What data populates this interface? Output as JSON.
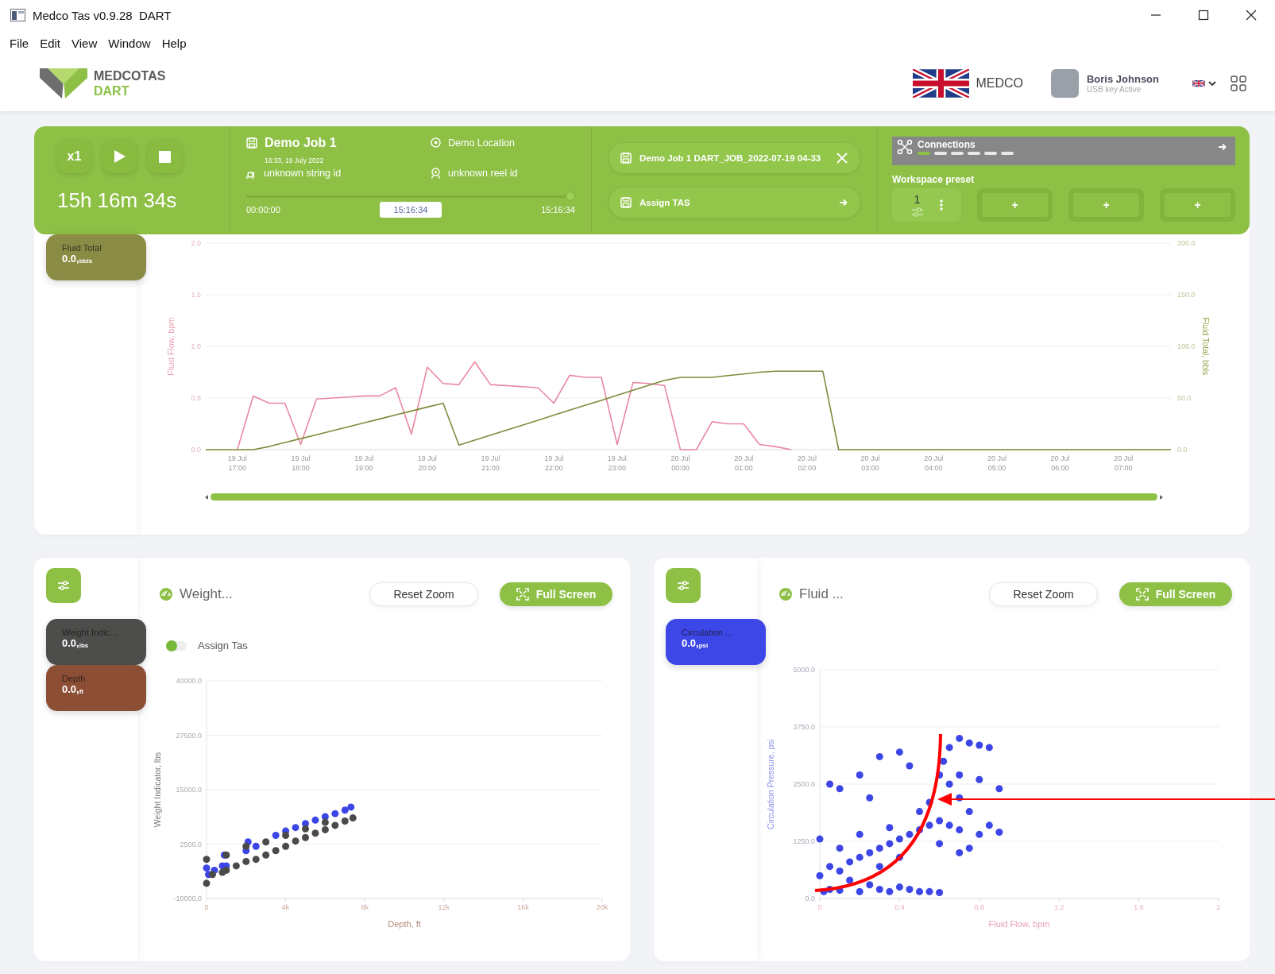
{
  "window": {
    "title": "Medco Tas v0.9.28  DART"
  },
  "menu": [
    "File",
    "Edit",
    "View",
    "Window",
    "Help"
  ],
  "header": {
    "logo": {
      "name": "MEDCOTAS",
      "sub": "DART"
    },
    "company": "MEDCO",
    "user": {
      "name": "Boris Johnson",
      "status": "USB key Active"
    }
  },
  "control_bar": {
    "speed": "x1",
    "elapsed": "15h 16m 34s",
    "job": {
      "title": "Demo Job 1",
      "date": "16:33, 19 July 2022",
      "string_id": "unknown string id",
      "location": "Demo Location",
      "reel_id": "unknown reel id"
    },
    "timeline": {
      "start": "00:00:00",
      "current": "15:16:34",
      "end": "15:16:34",
      "level": 1
    },
    "files": [
      {
        "label": "Demo Job 1 DART_JOB_2022-07-19 04-33",
        "kind": "close"
      },
      {
        "label": "Assign TAS",
        "kind": "arrow"
      }
    ],
    "connections": {
      "label": "Connections",
      "segments": [
        {
          "active": true
        },
        {
          "active": false
        },
        {
          "active": false
        },
        {
          "active": false
        },
        {
          "active": false
        },
        {
          "active": false
        }
      ]
    },
    "workspace": {
      "label": "Workspace preset",
      "slots": [
        {
          "kind": "preset",
          "label": "1"
        },
        {
          "kind": "add",
          "label": "+"
        },
        {
          "kind": "add",
          "label": "+"
        },
        {
          "kind": "add",
          "label": "+"
        }
      ]
    }
  },
  "trend_panel": {
    "badges": [
      {
        "label": "Fluid Total",
        "value": "0.0,$_{bbls}$",
        "color": "#8a8c45"
      }
    ],
    "chart_data": {
      "type": "line",
      "ylabel": "Fluid Flow, bpm",
      "y2label": "Fluid Total, bbls",
      "ylim": [
        0,
        2
      ],
      "y2lim": [
        0,
        200
      ],
      "categories": [
        null,
        null,
        "19 Jul 17:00",
        null,
        null,
        null,
        "19 Jul 18:00",
        null,
        null,
        null,
        "19 Jul 19:00",
        null,
        null,
        null,
        "19 Jul 20:00",
        null,
        null,
        null,
        "19 Jul 21:00",
        null,
        null,
        null,
        "19 Jul 22:00",
        null,
        null,
        null,
        "19 Jul 23:00",
        null,
        null,
        null,
        "20 Jul 00:00",
        null,
        null,
        null,
        "20 Jul 01:00",
        null,
        null,
        null,
        "20 Jul 02:00",
        null,
        null,
        null,
        "20 Jul 03:00",
        null,
        null,
        null,
        "20 Jul 04:00",
        null,
        null,
        null,
        "20 Jul 05:00",
        null,
        null,
        null,
        "20 Jul 06:00",
        null,
        null,
        null,
        "20 Jul 07:00",
        null,
        null,
        null
      ],
      "yticks": [
        {
          "value": 0,
          "label": "0.0"
        },
        {
          "value": 0.5,
          "label": "0.5"
        },
        {
          "value": 1,
          "label": "1.0"
        },
        {
          "value": 1.5,
          "label": "1.5"
        },
        {
          "value": 2,
          "label": "2.0"
        }
      ],
      "y2ticks": [
        {
          "value": 0,
          "label": "0.0"
        },
        {
          "value": 50,
          "label": "50.0"
        },
        {
          "value": 100,
          "label": "100.0"
        },
        {
          "value": 150,
          "label": "150.0"
        },
        {
          "value": 200,
          "label": "200.0"
        }
      ],
      "grid": true,
      "series": [
        {
          "color": "#e8899f",
          "axis": "y",
          "values": [
            null,
            null,
            0,
            0.52,
            0.45,
            0.45,
            0.05,
            0.49,
            0.5,
            0.51,
            0.52,
            0.52,
            0.6,
            0.15,
            0.8,
            0.64,
            0.63,
            0.85,
            0.63,
            0.62,
            0.61,
            0.6,
            0.45,
            0.72,
            0.7,
            0.7,
            0.05,
            0.65,
            0.64,
            0.62,
            0,
            0,
            0.27,
            0.25,
            0.25,
            0.05,
            0.03,
            0,
            null,
            null,
            null,
            null,
            null,
            null,
            null,
            null,
            null,
            null,
            null,
            null,
            null,
            null,
            null,
            null,
            null,
            null,
            null,
            null,
            null,
            null,
            null,
            null
          ]
        },
        {
          "color": "#7f8b3b",
          "axis": "y2",
          "values": [
            0,
            0,
            0,
            0,
            3,
            6.9,
            10.7,
            14.5,
            18.3,
            22.1,
            25.9,
            29.7,
            33.6,
            37.4,
            41.2,
            45,
            4.4,
            9.3,
            14.1,
            18.9,
            23.7,
            28.5,
            33.4,
            38.2,
            43,
            47.8,
            52.6,
            57.5,
            62.3,
            67.1,
            70,
            70,
            70,
            71.7,
            73.3,
            75,
            76,
            76,
            76,
            76,
            0,
            0,
            0,
            0,
            0,
            0,
            0,
            0,
            0,
            0,
            0,
            0,
            0,
            0,
            0,
            0,
            0,
            0,
            0,
            0,
            0,
            0
          ]
        }
      ]
    }
  },
  "scatter_panels": [
    {
      "title": "Weight...",
      "reset": "Reset Zoom",
      "fullscreen": "Full Screen",
      "badges": [
        {
          "label": "Weight Indic...",
          "value": "0.0,$_{lbs}$",
          "color": "#4d4d4b"
        },
        {
          "label": "Depth",
          "value": "0.0,$_{ft}$",
          "color": "#8c4f36"
        }
      ],
      "legend": {
        "label": "Assign Tas",
        "on": true
      },
      "chart_data": {
        "type": "scatter",
        "xlabel": "Depth, ft",
        "ylabel": "Weight Indicator, lbs",
        "xlim": [
          0,
          20000
        ],
        "ylim": [
          -10000,
          40000
        ],
        "xticks": [
          {
            "value": 0,
            "label": "0"
          },
          {
            "value": 4000,
            "label": "4k"
          },
          {
            "value": 8000,
            "label": "8k"
          },
          {
            "value": 12000,
            "label": "12k"
          },
          {
            "value": 16000,
            "label": "16k"
          },
          {
            "value": 20000,
            "label": "20k"
          }
        ],
        "grid": true,
        "yticks": [
          {
            "value": -10000,
            "label": "-10000.0"
          },
          {
            "value": 2500,
            "label": "2500.0"
          },
          {
            "value": 15000,
            "label": "15000.0"
          },
          {
            "value": 27500,
            "label": "27500.0"
          },
          {
            "value": 40000,
            "label": "40000.0"
          }
        ],
        "series": [
          {
            "color": "#3c46e6",
            "x": [
              0,
              100,
              400,
              800,
              1000,
              900,
              2000,
              2100,
              2500,
              3500,
              4000,
              4500,
              5000,
              5500,
              6000,
              6500,
              7000,
              7300
            ],
            "values": [
              -3000,
              -4500,
              -3500,
              -2500,
              -2500,
              0,
              1000,
              3000,
              2000,
              4500,
              5500,
              6300,
              7200,
              8000,
              8800,
              9500,
              10300,
              11000
            ]
          },
          {
            "color": "#4a4a48",
            "x": [
              0,
              0,
              300,
              800,
              1000,
              1000,
              1500,
              2000,
              2000,
              2500,
              3000,
              3000,
              3500,
              4000,
              4000,
              4500,
              5000,
              5000,
              5500,
              6000,
              6000,
              6500,
              7000,
              7400
            ],
            "values": [
              -6500,
              -1000,
              -4500,
              -4000,
              -3500,
              0,
              -2500,
              -1500,
              2000,
              -1000,
              0,
              3000,
              1000,
              2000,
              4500,
              3200,
              4000,
              6000,
              5000,
              5800,
              7500,
              6800,
              7800,
              8500
            ]
          }
        ]
      }
    },
    {
      "title": "Fluid ...",
      "reset": "Reset Zoom",
      "fullscreen": "Full Screen",
      "badges": [
        {
          "label": "Circulation ...",
          "value": "0.0,$_{psi}$",
          "color": "#3d47e8"
        }
      ],
      "chart_data": {
        "type": "scatter",
        "xlabel": "Fluid Flow, bpm",
        "ylabel": "Circulation Pressure, psi",
        "xlim": [
          0,
          2
        ],
        "ylim": [
          0,
          5000
        ],
        "xticks": [
          {
            "value": 0,
            "label": "0"
          },
          {
            "value": 0.4,
            "label": "0.4"
          },
          {
            "value": 0.8,
            "label": "0.8"
          },
          {
            "value": 1.2,
            "label": "1.2"
          },
          {
            "value": 1.6,
            "label": "1.6"
          },
          {
            "value": 2,
            "label": "2"
          }
        ],
        "grid": true,
        "yticks": [
          {
            "value": 0,
            "label": "0.0"
          },
          {
            "value": 1250,
            "label": "1250.0"
          },
          {
            "value": 2500,
            "label": "2500.0"
          },
          {
            "value": 3750,
            "label": "3750.0"
          },
          {
            "value": 5000,
            "label": "5000.0"
          }
        ],
        "series": [
          {
            "color": "#3c46e6",
            "x": [
              0.02,
              0.05,
              0.1,
              0.2,
              0.3,
              0.35,
              0.4,
              0.45,
              0.5,
              0.55,
              0.6,
              0.0,
              0.05,
              0.1,
              0.15,
              0.2,
              0.25,
              0.3,
              0.35,
              0.4,
              0.45,
              0.5,
              0.55,
              0.6,
              0.65,
              0.7,
              0.8,
              0.9,
              0.85,
              0.75,
              0.7,
              0.65,
              0.6,
              0.62,
              0.65,
              0.7,
              0.75,
              0.8,
              0.85,
              0.9,
              0.8,
              0.7,
              0.05,
              0.1,
              0.2,
              0.25,
              0.3,
              0.4,
              0.45,
              0.0,
              0.1,
              0.2,
              0.35,
              0.5,
              0.55,
              0.3,
              0.4,
              0.6,
              0.7,
              0.75,
              0.15,
              0.25
            ],
            "values": [
              150,
              200,
              180,
              150,
              200,
              150,
              250,
              200,
              150,
              150,
              130,
              500,
              700,
              600,
              800,
              900,
              1000,
              1100,
              1200,
              1300,
              1400,
              1500,
              1600,
              1700,
              1600,
              1500,
              1400,
              1450,
              1600,
              1900,
              2200,
              2500,
              2700,
              3000,
              3300,
              3500,
              3400,
              3350,
              3300,
              2400,
              2600,
              2700,
              2500,
              2400,
              2700,
              2200,
              3100,
              3200,
              2900,
              1300,
              1100,
              1400,
              1550,
              1900,
              2100,
              700,
              900,
              1200,
              1000,
              1100,
              400,
              300
            ]
          }
        ]
      }
    }
  ]
}
